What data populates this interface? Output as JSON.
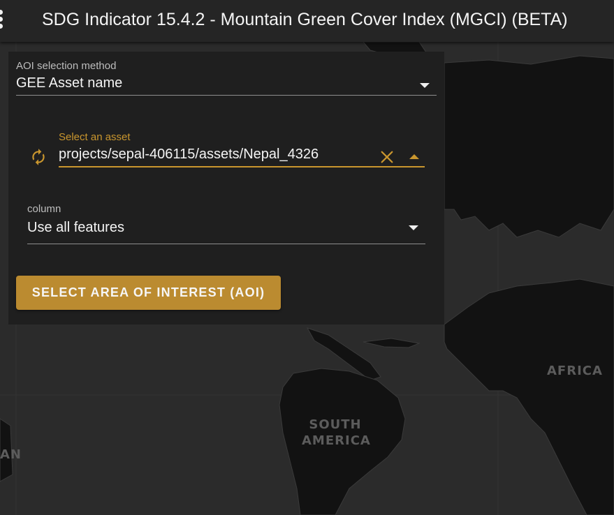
{
  "app_bar": {
    "title": "SDG Indicator 15.4.2 - Mountain Green Cover Index (MGCI) (BETA)",
    "menu_icon": "more-vertical-icon"
  },
  "map": {
    "labels": {
      "africa": "AFRICA",
      "south_america_line1": "SOUTH",
      "south_america_line2": "AMERICA",
      "partial_left": "AN"
    },
    "colors": {
      "ocean": "#2b2b2b",
      "land": "#121212",
      "borders": "#3a3a3a"
    }
  },
  "aoi_panel": {
    "method": {
      "label": "AOI selection method",
      "value": "GEE Asset name"
    },
    "asset": {
      "label": "Select an asset",
      "value": "projects/sepal-406115/assets/Nepal_4326",
      "refresh_icon": "refresh-icon",
      "clear_icon": "close-icon"
    },
    "column": {
      "label": "column",
      "value": "Use all features"
    },
    "button": {
      "label": "SELECT AREA OF INTEREST (AOI)"
    }
  },
  "colors": {
    "accent": "#bb8b30",
    "accent_text": "#c9962e",
    "panel_bg": "#1f1f1f",
    "app_bar_bg": "#252525"
  }
}
